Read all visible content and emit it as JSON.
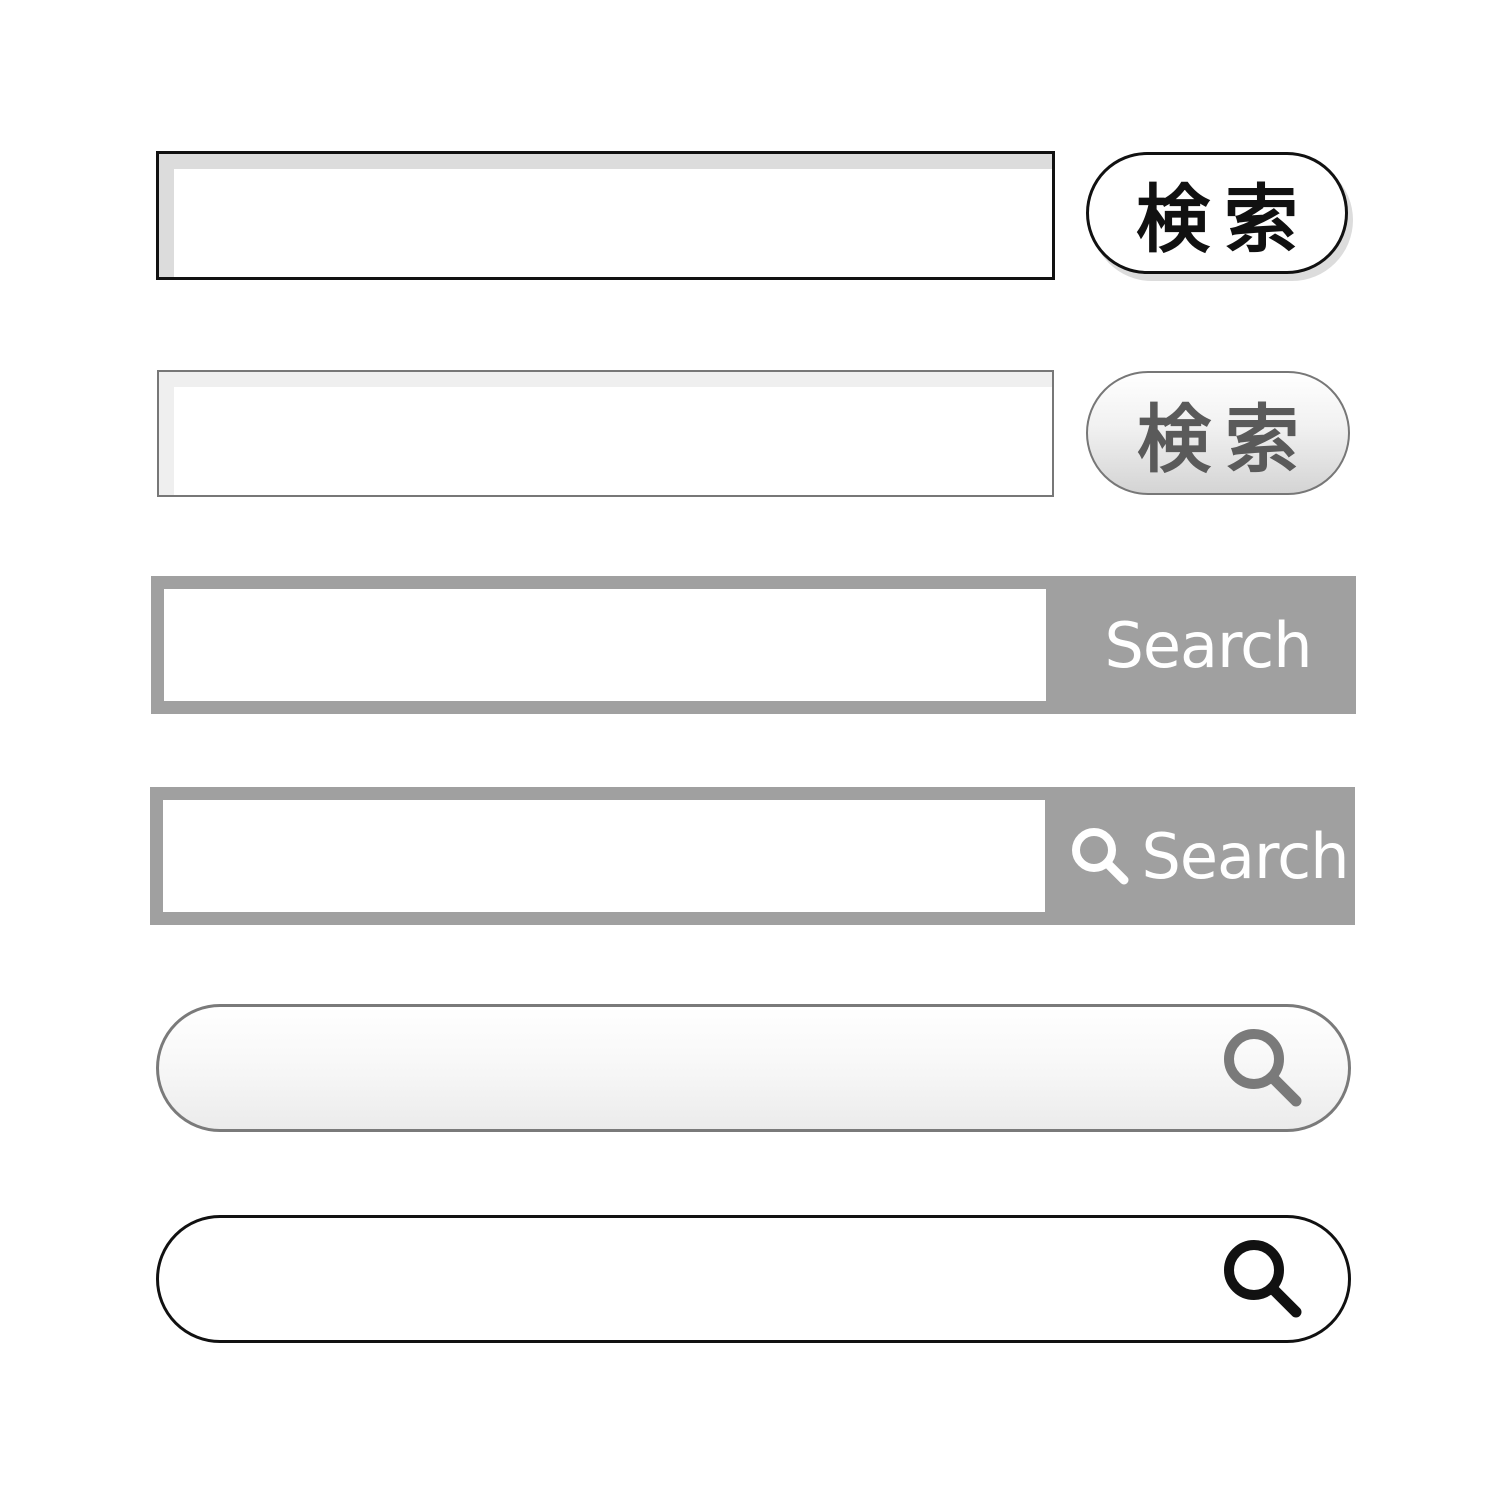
{
  "search_bars": [
    {
      "style": "black-outline-with-pill-button",
      "input_value": "",
      "button_label": "検索",
      "colors": {
        "border": "#111111",
        "shadow": "#dcdcdc"
      }
    },
    {
      "style": "grey-outline-with-gradient-pill-button",
      "input_value": "",
      "button_label": "検索",
      "colors": {
        "border": "#777777",
        "text": "#5a5a5a"
      }
    },
    {
      "style": "grey-frame-with-text-button",
      "input_value": "",
      "button_label": "Search",
      "colors": {
        "frame": "#a0a0a0",
        "text": "#ffffff"
      }
    },
    {
      "style": "grey-frame-with-icon-text-button",
      "input_value": "",
      "button_label": "Search",
      "button_icon": "search-icon",
      "colors": {
        "frame": "#a0a0a0",
        "text": "#ffffff"
      }
    },
    {
      "style": "rounded-grey-gradient-with-icon",
      "input_value": "",
      "button_icon": "search-icon",
      "colors": {
        "border": "#7a7a7a",
        "icon": "#7a7a7a"
      }
    },
    {
      "style": "rounded-black-outline-with-icon",
      "input_value": "",
      "button_icon": "search-icon",
      "colors": {
        "border": "#111111",
        "icon": "#111111"
      }
    }
  ]
}
